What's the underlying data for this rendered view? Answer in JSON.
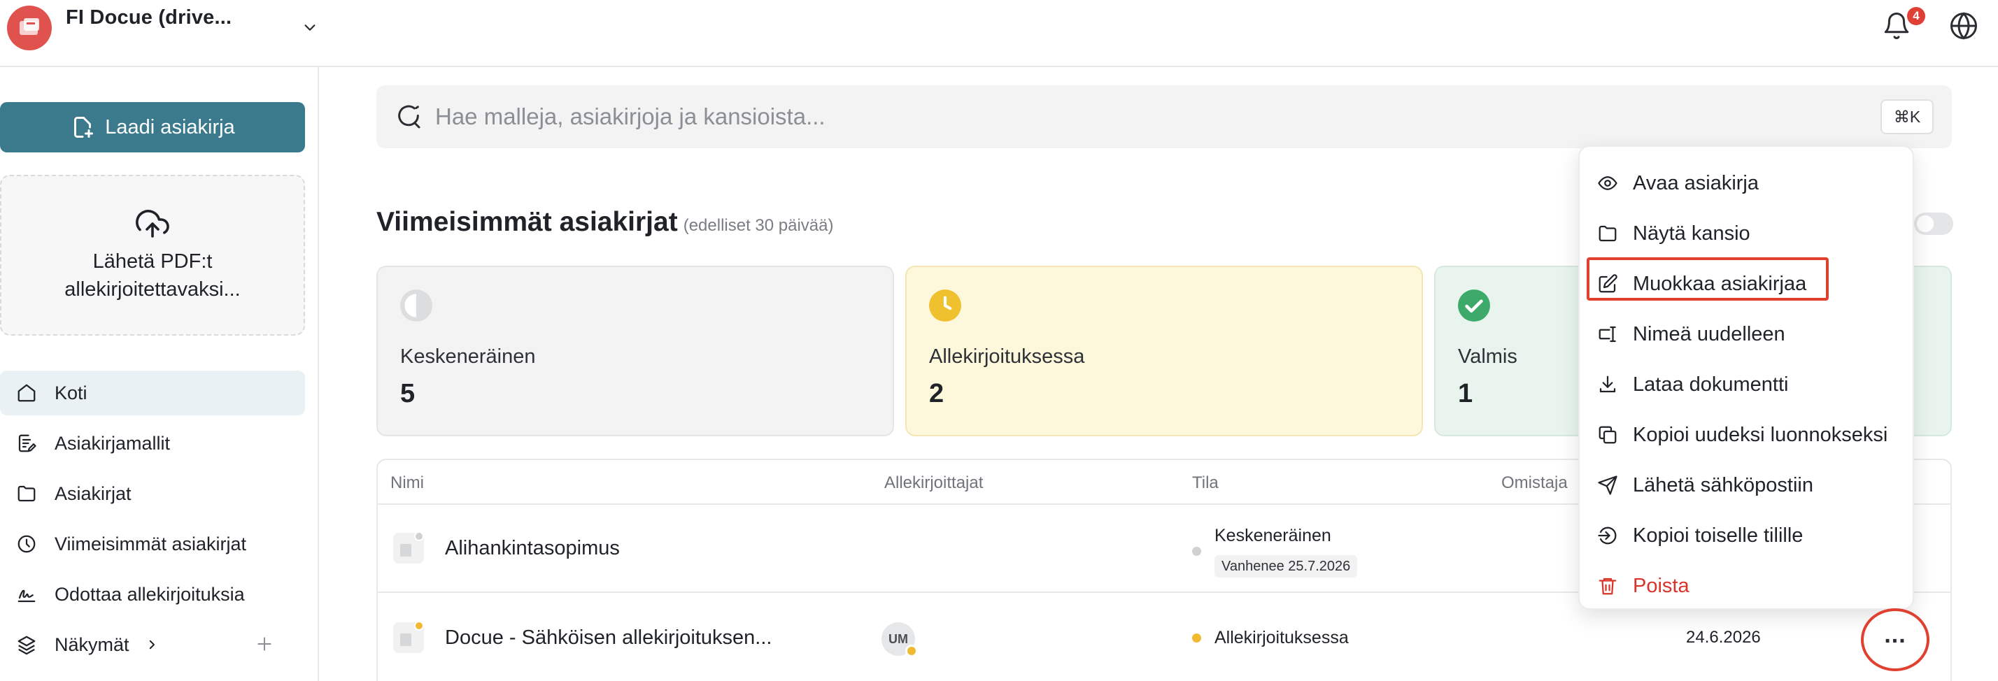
{
  "header": {
    "org_name": "FI Docue (drive...",
    "notification_count": "4"
  },
  "sidebar": {
    "create_label": "Laadi asiakirja",
    "upload_label": "Lähetä PDF:t allekirjoitettavaksi...",
    "items": [
      {
        "label": "Koti",
        "icon": "home-icon",
        "active": true
      },
      {
        "label": "Asiakirjamallit",
        "icon": "template-icon"
      },
      {
        "label": "Asiakirjat",
        "icon": "folder-icon"
      },
      {
        "label": "Viimeisimmät asiakirjat",
        "icon": "clock-icon"
      },
      {
        "label": "Odottaa allekirjoituksia",
        "icon": "signature-icon"
      },
      {
        "label": "Näkymät",
        "icon": "layers-icon"
      }
    ]
  },
  "search": {
    "placeholder": "Hae malleja, asiakirjoja ja kansioista...",
    "shortcut": "⌘K"
  },
  "recent": {
    "title": "Viimeisimmät asiakirjat",
    "subtitle": "(edelliset 30 päivää)"
  },
  "stats": [
    {
      "label": "Keskeneräinen",
      "value": "5",
      "color": "#d8d9db"
    },
    {
      "label": "Allekirjoituksessa",
      "value": "2",
      "color": "#f0c12e"
    },
    {
      "label": "Valmis",
      "value": "1",
      "color": "#3daa6a"
    }
  ],
  "table": {
    "columns": [
      "Nimi",
      "Allekirjoittajat",
      "Tila",
      "Omistaja"
    ],
    "rows": [
      {
        "name": "Alihankintasopimus",
        "status": "Keskeneräinen",
        "expiry": "Vanhenee 25.7.2026",
        "status_color": "#d0d1d3"
      },
      {
        "name": "Docue - Sähköisen allekirjoituksen...",
        "signer": "UM",
        "status": "Allekirjoituksessa",
        "date": "24.6.2026",
        "status_color": "#f0b931"
      }
    ]
  },
  "context_menu": {
    "items": [
      {
        "label": "Avaa asiakirja",
        "icon": "eye-icon"
      },
      {
        "label": "Näytä kansio",
        "icon": "folder-icon"
      },
      {
        "label": "Muokkaa asiakirjaa",
        "icon": "edit-icon"
      },
      {
        "label": "Nimeä uudelleen",
        "icon": "rename-icon"
      },
      {
        "label": "Lataa dokumentti",
        "icon": "download-icon"
      },
      {
        "label": "Kopioi uudeksi luonnokseksi",
        "icon": "copy-icon"
      },
      {
        "label": "Lähetä sähköpostiin",
        "icon": "send-icon"
      },
      {
        "label": "Kopioi toiselle tilille",
        "icon": "transfer-icon"
      },
      {
        "label": "Poista",
        "icon": "trash-icon"
      }
    ]
  },
  "colors": {
    "accent": "#3a7a8c",
    "danger": "#d9342b",
    "highlight": "#e0402f"
  }
}
